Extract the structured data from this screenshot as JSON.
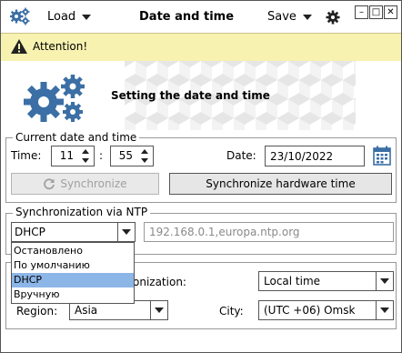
{
  "titlebar": {
    "load_label": "Load",
    "title": "Date and time",
    "save_label": "Save",
    "minimize": "–",
    "maximize": "□",
    "close": "✕"
  },
  "attention": {
    "text": "Attention!"
  },
  "banner": {
    "title": "Setting the date and time"
  },
  "current": {
    "legend": "Current date and time",
    "time_label": "Time:",
    "hour": "11",
    "separator": ":",
    "minute": "55",
    "date_label": "Date:",
    "date": "23/10/2022",
    "sync_button": "Synchronize",
    "sync_hw_button": "Synchronize hardware time"
  },
  "ntp": {
    "legend": "Synchronization via NTP",
    "mode": "DHCP",
    "servers": "192.168.0.1,europa.ntp.org",
    "options": [
      "Остановлено",
      "По умолчанию",
      "DHCP",
      "Вручную"
    ],
    "selected_index": 2
  },
  "timezone": {
    "sync_label_partial": "onization:",
    "sync_value": "Local time",
    "region_label": "Region:",
    "region_value": "Asia",
    "city_label": "City:",
    "city_value": "(UTC +06) Omsk"
  },
  "colors": {
    "attention_bg": "#f7f2b0",
    "gear": "#3b6fa5",
    "selected_item": "#8db6e8"
  }
}
